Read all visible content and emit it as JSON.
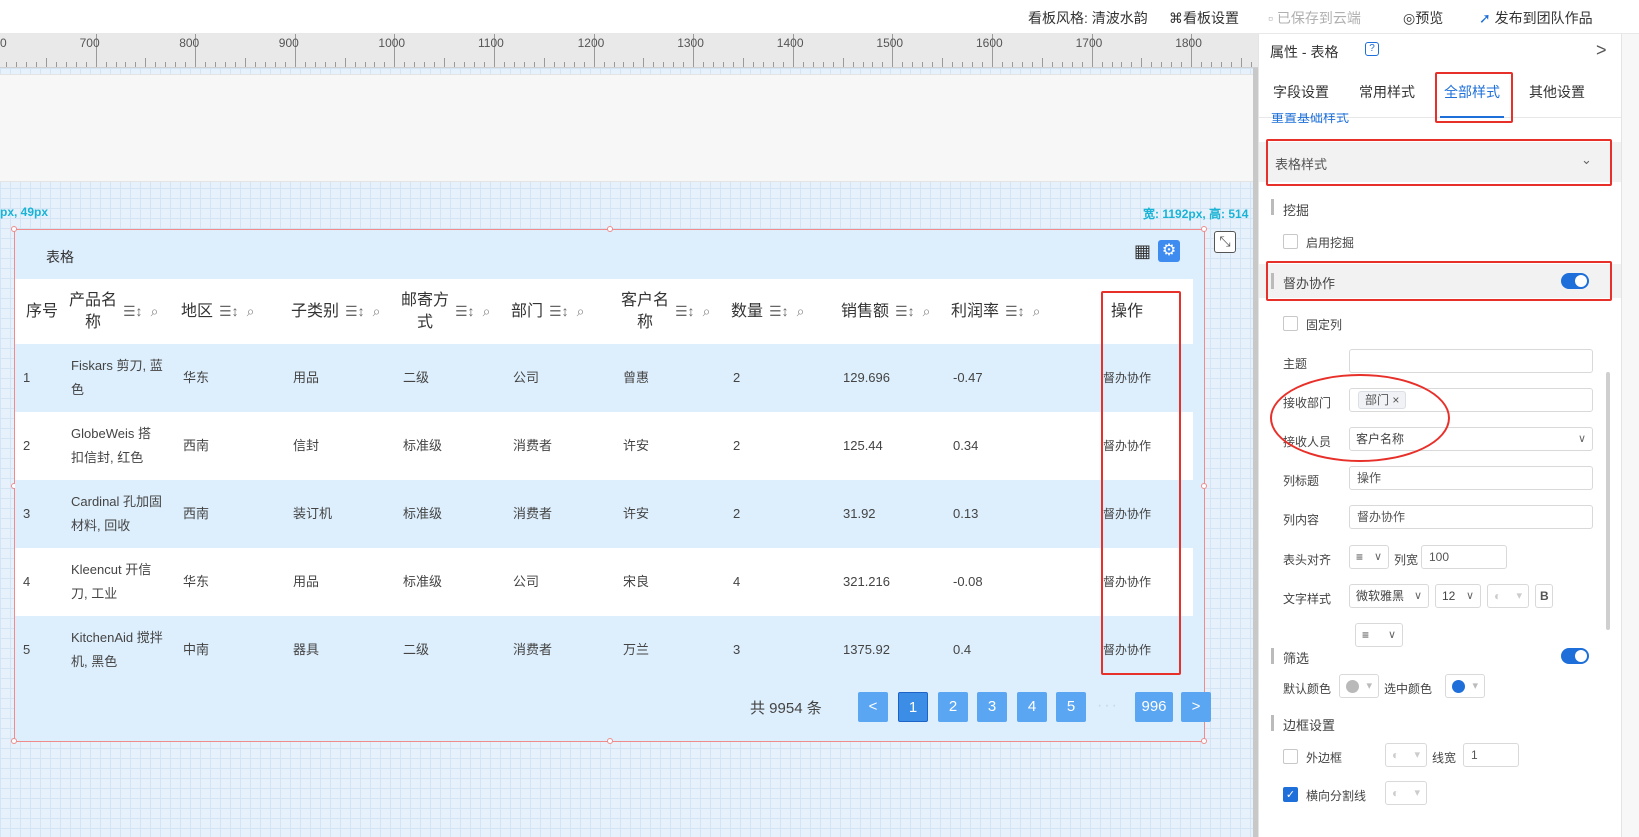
{
  "topbar": {
    "theme_label": "看板风格: 清波水韵",
    "settings_label": "⌘看板设置",
    "saved_label": "已保存到云端",
    "preview_label": "预览",
    "publish_label": "发布到团队作品"
  },
  "ruler": {
    "marks": [
      "700",
      "800",
      "900",
      "1000",
      "1100",
      "1200",
      "1300",
      "1400",
      "1500",
      "1600",
      "1700",
      "1800"
    ]
  },
  "canvas": {
    "pos_label": "px, 49px",
    "size_label": "宽: 1192px, 高: 514"
  },
  "table": {
    "title": "表格",
    "columns": [
      "序号",
      "产品名称",
      "地区",
      "子类别",
      "邮寄方式",
      "部门",
      "客户名称",
      "数量",
      "销售额",
      "利润率",
      "操作"
    ],
    "rows": [
      [
        "1",
        "Fiskars 剪刀, 蓝色",
        "华东",
        "用品",
        "二级",
        "公司",
        "曾惠",
        "2",
        "129.696",
        "-0.47",
        "督办协作"
      ],
      [
        "2",
        "GlobeWeis 搭扣信封, 红色",
        "西南",
        "信封",
        "标准级",
        "消费者",
        "许安",
        "2",
        "125.44",
        "0.34",
        "督办协作"
      ],
      [
        "3",
        "Cardinal 孔加固材料, 回收",
        "西南",
        "装订机",
        "标准级",
        "消费者",
        "许安",
        "2",
        "31.92",
        "0.13",
        "督办协作"
      ],
      [
        "4",
        "Kleencut 开信刀, 工业",
        "华东",
        "用品",
        "标准级",
        "公司",
        "宋良",
        "4",
        "321.216",
        "-0.08",
        "督办协作"
      ],
      [
        "5",
        "KitchenAid 搅拌机, 黑色",
        "中南",
        "器具",
        "二级",
        "消费者",
        "万兰",
        "3",
        "1375.92",
        "0.4",
        "督办协作"
      ]
    ],
    "pager": {
      "total": "共 9954 条",
      "prev": "<",
      "pages": [
        "1",
        "2",
        "3",
        "4",
        "5"
      ],
      "dots": "···",
      "last": "996",
      "next": ">"
    }
  },
  "panel": {
    "header": "属性 - 表格",
    "help_icon": "?",
    "collapse": ">",
    "tabs": [
      "字段设置",
      "常用样式",
      "全部样式",
      "其他设置"
    ],
    "active_tab": "全部样式",
    "hidden_link": "重置基础样式",
    "table_style": "表格样式",
    "mining": "挖掘",
    "enable_mining": "启用挖掘",
    "collab": "督办协作",
    "fixed_col": "固定列",
    "subject_label": "主题",
    "subject_value": "",
    "recv_dept_label": "接收部门",
    "recv_dept_tag": "部门",
    "recv_person_label": "接收人员",
    "recv_person_value": "客户名称",
    "col_title_label": "列标题",
    "col_title_value": "操作",
    "col_content_label": "列内容",
    "col_content_value": "督办协作",
    "header_align_label": "表头对齐",
    "col_width_label": "列宽",
    "col_width_value": "100",
    "text_style_label": "文字样式",
    "font_value": "微软雅黑",
    "font_size_value": "12",
    "bold_label": "B",
    "filter_label": "筛选",
    "default_color_label": "默认颜色",
    "selected_color_label": "选中颜色",
    "border_label": "边框设置",
    "outer_border_label": "外边框",
    "line_width_label": "线宽",
    "line_width_value": "1",
    "hline_label": "横向分割线",
    "colors": {
      "accent": "#1e6fd9",
      "default_dot": "#b9b9b9",
      "selected_dot": "#1e6fd9"
    }
  }
}
